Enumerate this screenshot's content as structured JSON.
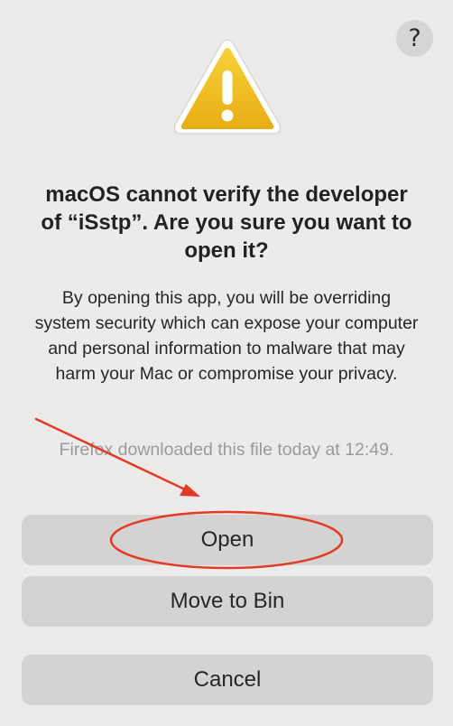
{
  "help": {
    "label": "?"
  },
  "dialog": {
    "title": "macOS cannot verify the developer of “iSstp”. Are you sure you want to open it?",
    "body": "By opening this app, you will be overriding system security which can expose your computer and personal information to malware that may harm your Mac or compromise your privacy.",
    "download_info": "Firefox downloaded this file today at 12:49."
  },
  "buttons": {
    "open": "Open",
    "move_to_bin": "Move to Bin",
    "cancel": "Cancel"
  },
  "icons": {
    "warning": "warning-triangle-icon",
    "help": "question-mark-icon"
  },
  "colors": {
    "background": "#ecebea",
    "button": "#d4d3d2",
    "warning_yellow": "#f2c01e",
    "annotation_red": "#e23a26"
  }
}
